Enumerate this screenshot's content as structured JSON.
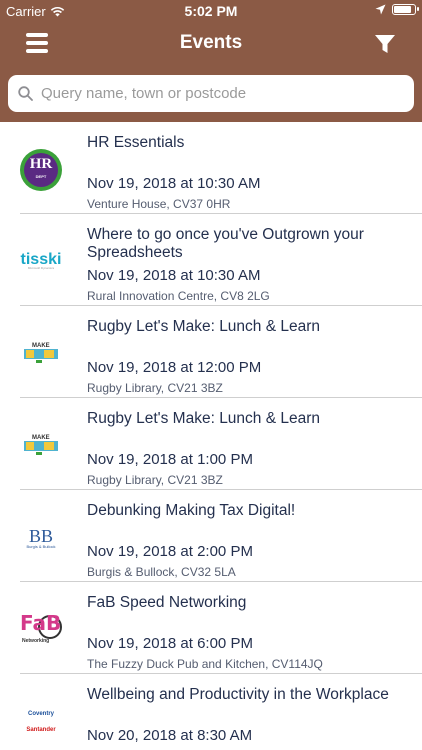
{
  "status_bar": {
    "carrier": "Carrier",
    "time": "5:02 PM",
    "battery_level": 0.9
  },
  "nav": {
    "title": "Events",
    "menu_icon": "hamburger-menu-icon",
    "filter_icon": "filter-funnel-icon"
  },
  "search": {
    "placeholder": "Query name, town or postcode",
    "value": ""
  },
  "events": [
    {
      "title": "HR Essentials",
      "date": "Nov 19, 2018 at 10:30 AM",
      "location": "Venture House, CV37 0HR",
      "logo": "hr-dept-logo",
      "logo_text": "HR",
      "logo_subtext": "DEPT"
    },
    {
      "title": "Where to go once you've Outgrown your Spreadsheets",
      "date": "Nov 19, 2018 at 10:30 AM",
      "location": "Rural Innovation Centre, CV8 2LG",
      "logo": "tisski-logo",
      "logo_text": "tisski"
    },
    {
      "title": "Rugby Let's Make: Lunch & Learn",
      "date": "Nov 19, 2018 at 12:00 PM",
      "location": "Rugby Library, CV21 3BZ",
      "logo": "lets-make-logo",
      "logo_text": "MAKE"
    },
    {
      "title": "Rugby Let's Make: Lunch & Learn",
      "date": "Nov 19, 2018 at 1:00 PM",
      "location": "Rugby Library, CV21 3BZ",
      "logo": "lets-make-logo",
      "logo_text": "MAKE"
    },
    {
      "title": "Debunking Making Tax Digital!",
      "date": "Nov 19, 2018 at 2:00 PM",
      "location": "Burgis & Bullock, CV32 5LA",
      "logo": "burgis-bullock-logo",
      "logo_text": "BB",
      "logo_subtext": "Burgis & Bullock"
    },
    {
      "title": "FaB Speed Networking",
      "date": "Nov 19, 2018 at 6:00 PM",
      "location": "The Fuzzy Duck Pub and Kitchen, CV114JQ",
      "logo": "fab-networking-logo",
      "logo_text": "FaB",
      "logo_subtext": "Networking"
    },
    {
      "title": "Wellbeing and Productivity in the Workplace",
      "date": "Nov 20, 2018 at 8:30 AM",
      "location": "",
      "logo": "coventry-santander-logo",
      "logo_text": "Coventry",
      "logo_subtext": "Santander"
    }
  ],
  "colors": {
    "brand": "#8b5a45",
    "text": "#24304e",
    "subtext": "#555d70",
    "separator": "#cfcfcf"
  }
}
